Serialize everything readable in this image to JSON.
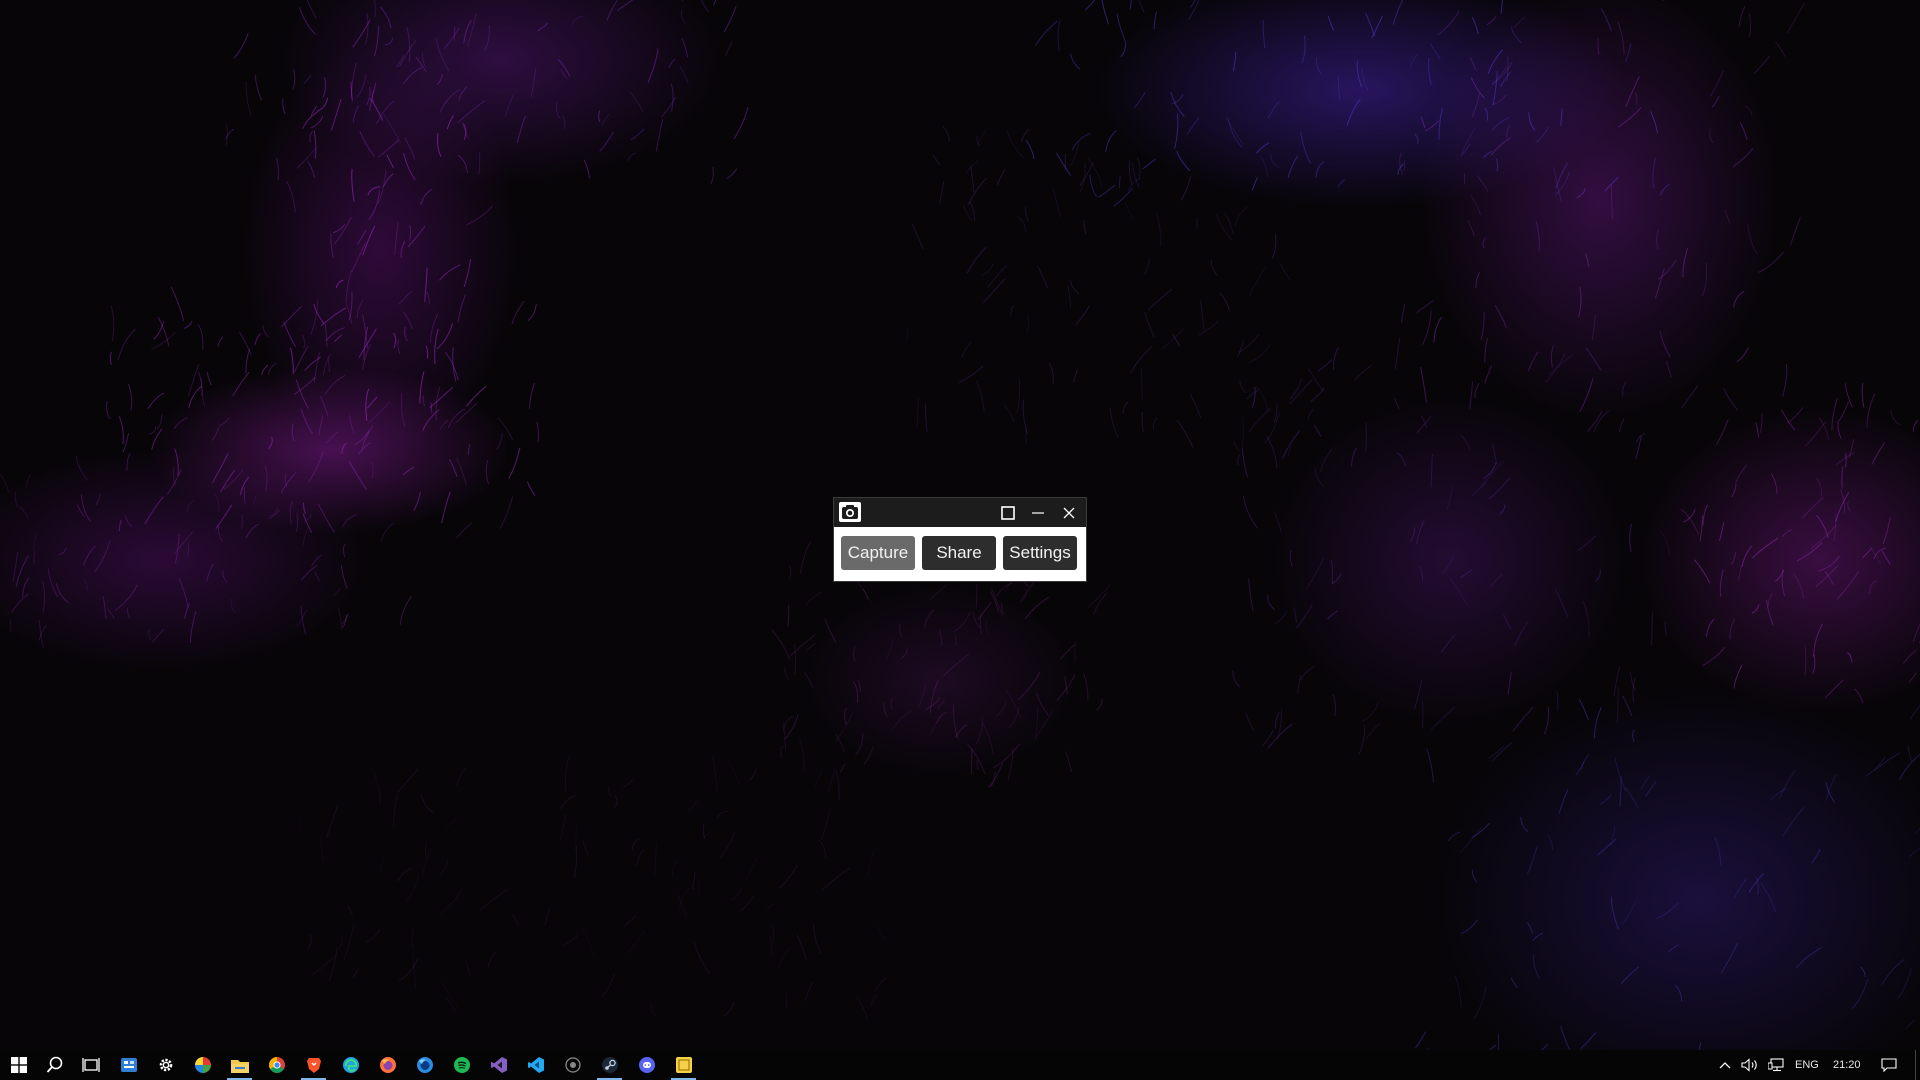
{
  "desktop": {
    "colors": {
      "background": "#070508",
      "accent_purple": "#9a2fc0",
      "accent_blue": "#5a3fd8"
    }
  },
  "app_window": {
    "icon": "camera-icon",
    "controls": {
      "maximize": "maximize-icon",
      "minimize": "minimize-icon",
      "close": "close-icon"
    },
    "buttons": {
      "capture": "Capture",
      "share": "Share",
      "settings": "Settings"
    },
    "colors": {
      "titlebar": "#1c1c1c",
      "capture_bg": "#6a6a6a",
      "button_bg": "#2d2d2d"
    }
  },
  "taskbar": {
    "pinned_icons": [
      "windows-start-icon",
      "search-icon",
      "task-view-icon",
      "widget-icon",
      "settings-gear-icon",
      "color-app-icon",
      "file-explorer-icon",
      "chrome-icon",
      "brave-icon",
      "edge-icon",
      "firefox-icon",
      "firefox-developer-icon",
      "spotify-icon",
      "visual-studio-icon",
      "vscode-icon",
      "github-desktop-icon",
      "steam-icon",
      "discord-icon",
      "screenshot-app-icon"
    ],
    "tray": {
      "icons": [
        "chevron-up-icon",
        "volume-icon",
        "network-icon",
        "notification-icon"
      ],
      "language": "ENG",
      "time": "21:20"
    }
  }
}
